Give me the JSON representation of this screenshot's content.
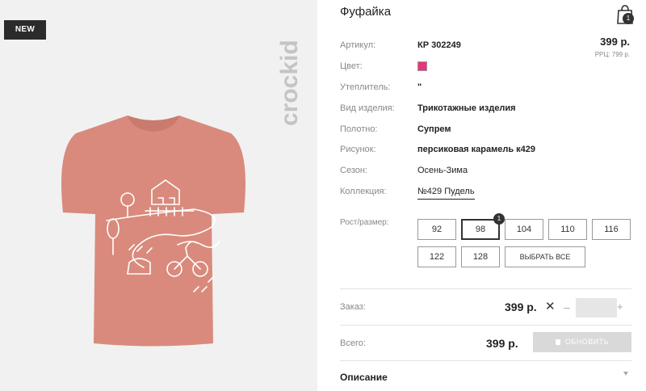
{
  "badge": "NEW",
  "brand": "crockid",
  "product": {
    "title": "Фуфайка",
    "price": "399 р.",
    "rrc": "РРЦ: 799 р."
  },
  "cart": {
    "count": "1"
  },
  "details": [
    {
      "label": "Артикул:",
      "value": "КР 302249"
    },
    {
      "label": "Цвет:",
      "color": "#e8347a"
    },
    {
      "label": "Утеплитель:",
      "value": "\""
    },
    {
      "label": "Вид изделия:",
      "value": "Трикотажные изделия"
    },
    {
      "label": "Полотно:",
      "value": "Супрем"
    },
    {
      "label": "Рисунок:",
      "value": "персиковая карамель к429"
    },
    {
      "label": "Сезон:",
      "value": "Осень-Зима"
    },
    {
      "label": "Коллекция:",
      "value": "№429 Пудель"
    }
  ],
  "sizes": {
    "label": "Рост/размер:",
    "options": [
      "92",
      "98",
      "104",
      "110",
      "116",
      "122",
      "128"
    ],
    "selected": "98",
    "selected_count": "1",
    "select_all": "ВЫБРАТЬ ВСЕ"
  },
  "order": {
    "label": "Заказ:",
    "price": "399 р.",
    "remove": "✕",
    "minus": "–",
    "plus": "+",
    "qty": ""
  },
  "total": {
    "label": "Всего:",
    "price": "399 р.",
    "update": "ОБНОВИТЬ"
  },
  "description": {
    "label": "Описание"
  }
}
